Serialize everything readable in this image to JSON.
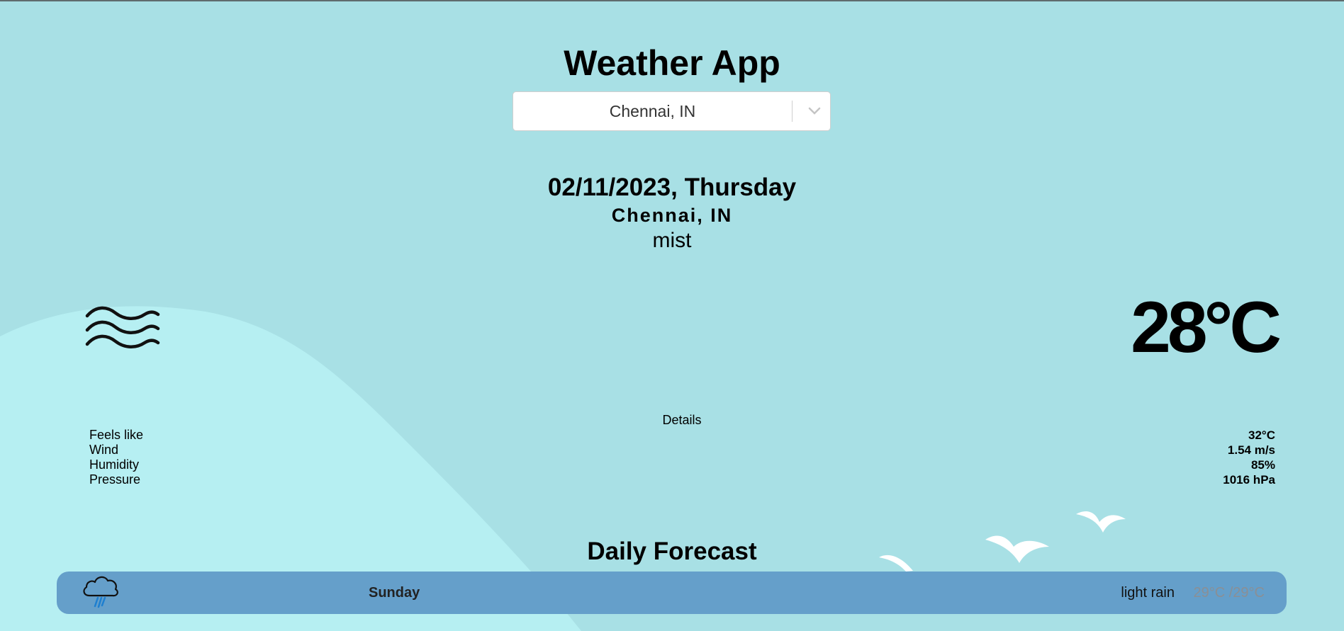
{
  "app": {
    "title": "Weather App"
  },
  "search": {
    "selected_city": "Chennai, IN",
    "dropdown_icon": "chevron-down-icon"
  },
  "current": {
    "date": "02/11/2023, Thursday",
    "location": "Chennai, IN",
    "description": "mist",
    "icon": "mist-icon",
    "temperature": "28°C"
  },
  "details": {
    "title": "Details",
    "items": [
      {
        "label": "Feels like",
        "value": "32°C"
      },
      {
        "label": "Wind",
        "value": "1.54 m/s"
      },
      {
        "label": "Humidity",
        "value": "85%"
      },
      {
        "label": "Pressure",
        "value": "1016 hPa"
      }
    ]
  },
  "forecast": {
    "title": "Daily Forecast",
    "days": [
      {
        "day": "Sunday",
        "description": "light rain",
        "temp_range": "29°C /29°C",
        "icon": "rain-cloud-icon"
      }
    ]
  },
  "colors": {
    "background": "#a8e0e5",
    "hill": "#b6eff2",
    "forecast_row": "#659fca",
    "bird": "#ffffff"
  }
}
